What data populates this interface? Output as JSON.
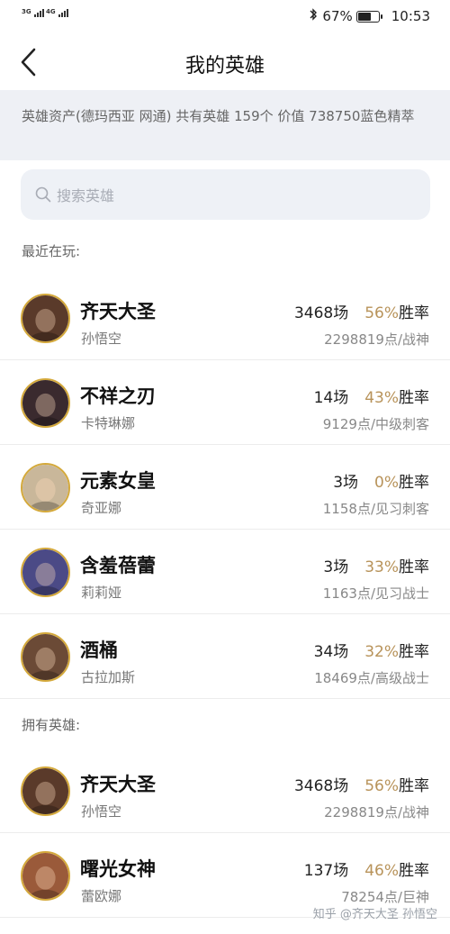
{
  "status_bar": {
    "signal1": "3G",
    "signal2": "4G",
    "battery_percent": "67%",
    "battery_level": 0.67,
    "time": "10:53"
  },
  "nav": {
    "title": "我的英雄"
  },
  "summary": {
    "text": "英雄资产(德玛西亚 网通) 共有英雄 159个 价值 738750蓝色精萃"
  },
  "search": {
    "placeholder": "搜索英雄"
  },
  "recent_label": "最近在玩:",
  "owned_label": "拥有英雄:",
  "recent": [
    {
      "name": "齐天大圣",
      "sub": "孙悟空",
      "games": "3468场",
      "winrate": "56%",
      "winrate_label": "胜率",
      "points": "2298819点/战神",
      "avatar_color": "#5a3a2a"
    },
    {
      "name": "不祥之刃",
      "sub": "卡特琳娜",
      "games": "14场",
      "winrate": "43%",
      "winrate_label": "胜率",
      "points": "9129点/中级刺客",
      "avatar_color": "#3a2a2e"
    },
    {
      "name": "元素女皇",
      "sub": "奇亚娜",
      "games": "3场",
      "winrate": "0%",
      "winrate_label": "胜率",
      "points": "1158点/见习刺客",
      "avatar_color": "#c9b79a"
    },
    {
      "name": "含羞蓓蕾",
      "sub": "莉莉娅",
      "games": "3场",
      "winrate": "33%",
      "winrate_label": "胜率",
      "points": "1163点/见习战士",
      "avatar_color": "#4b4a86"
    },
    {
      "name": "酒桶",
      "sub": "古拉加斯",
      "games": "34场",
      "winrate": "32%",
      "winrate_label": "胜率",
      "points": "18469点/高级战士",
      "avatar_color": "#6b4a36"
    }
  ],
  "owned": [
    {
      "name": "齐天大圣",
      "sub": "孙悟空",
      "games": "3468场",
      "winrate": "56%",
      "winrate_label": "胜率",
      "points": "2298819点/战神",
      "avatar_color": "#5a3a2a"
    },
    {
      "name": "曙光女神",
      "sub": "蕾欧娜",
      "games": "137场",
      "winrate": "46%",
      "winrate_label": "胜率",
      "points": "78254点/巨神",
      "avatar_color": "#9a5a3a"
    }
  ],
  "watermark": "知乎 @齐天大圣 孙悟空"
}
